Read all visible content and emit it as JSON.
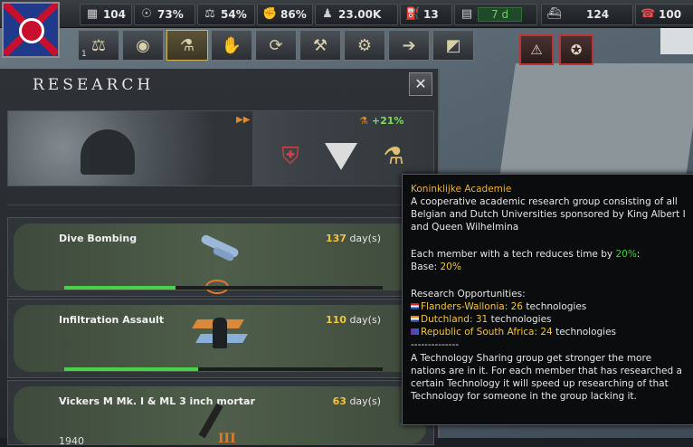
{
  "topbar": {
    "stats": [
      {
        "icon": "factory-icon",
        "value": "104"
      },
      {
        "icon": "stability-icon",
        "value": "73%"
      },
      {
        "icon": "scales-icon",
        "value": "54%"
      },
      {
        "icon": "war-support-icon",
        "value": "86%"
      },
      {
        "icon": "manpower-icon",
        "value": "23.00K"
      },
      {
        "icon": "fuel-icon",
        "value": "13"
      },
      {
        "icon": "decision-icon",
        "value": "7 d"
      },
      {
        "icon": "convoy-icon",
        "value": "124"
      },
      {
        "icon": "telephone-icon",
        "value": "100"
      }
    ]
  },
  "nav": {
    "production_count": "1",
    "buttons": [
      {
        "icon": "gavel-icon",
        "symbol": "⚖"
      },
      {
        "icon": "eye-icon",
        "symbol": "◉"
      },
      {
        "icon": "research-icon",
        "symbol": "⚗"
      },
      {
        "icon": "handshake-icon",
        "symbol": "✋"
      },
      {
        "icon": "logistics-icon",
        "symbol": "⟳"
      },
      {
        "icon": "hammer-icon",
        "symbol": "⚒"
      },
      {
        "icon": "gear-icon",
        "symbol": "⚙"
      },
      {
        "icon": "signpost-icon",
        "symbol": "➔"
      },
      {
        "icon": "ruler-icon",
        "symbol": "◩"
      }
    ],
    "alerts": [
      {
        "icon": "alert-gavel-icon",
        "symbol": "⚠"
      },
      {
        "icon": "alert-unit-icon",
        "symbol": "✪"
      }
    ]
  },
  "research": {
    "title": "Research",
    "close_symbol": "✕",
    "banner": {
      "speed_symbol": "▶▶",
      "bonus": "+21%"
    },
    "slots": [
      {
        "name": "Dive Bombing",
        "days_num": "137",
        "days_unit": " day(s)",
        "progress": 0.35,
        "year": "",
        "tier": ""
      },
      {
        "name": "Infiltration Assault",
        "days_num": "110",
        "days_unit": " day(s)",
        "progress": 0.42,
        "year": "",
        "tier": ""
      },
      {
        "name": "Vickers M Mk. I & ML 3 inch mortar",
        "days_num": "63",
        "days_unit": " day(s)",
        "progress": 0.0,
        "year": "1940",
        "tier": "III"
      }
    ]
  },
  "tooltip": {
    "title": "Koninklijke Academie",
    "desc": "A cooperative academic research group consisting of all Belgian and Dutch Universities sponsored by King Albert I and Queen Wilhelmina",
    "each_member_prefix": "Each member with a tech reduces time by ",
    "each_member_value": "20%",
    "each_member_suffix": ":",
    "base_label": "Base: ",
    "base_value": "20%",
    "opportunities_label": "Research Opportunities:",
    "opportunities": [
      {
        "country": "Flanders-Wallonia",
        "count": "26",
        "suffix": " technologies",
        "flag": "nl"
      },
      {
        "country": "Dutchland",
        "count": "31",
        "suffix": " technologies",
        "flag": "dl"
      },
      {
        "country": "Republic of South Africa",
        "count": "24",
        "suffix": " technologies",
        "flag": "za"
      }
    ],
    "separator": "--------------",
    "sharing": "A Technology Sharing group get stronger the more nations are in it. For each member that has researched a certain Technology it will speed up researching of that Technology for someone in the group lacking it."
  }
}
